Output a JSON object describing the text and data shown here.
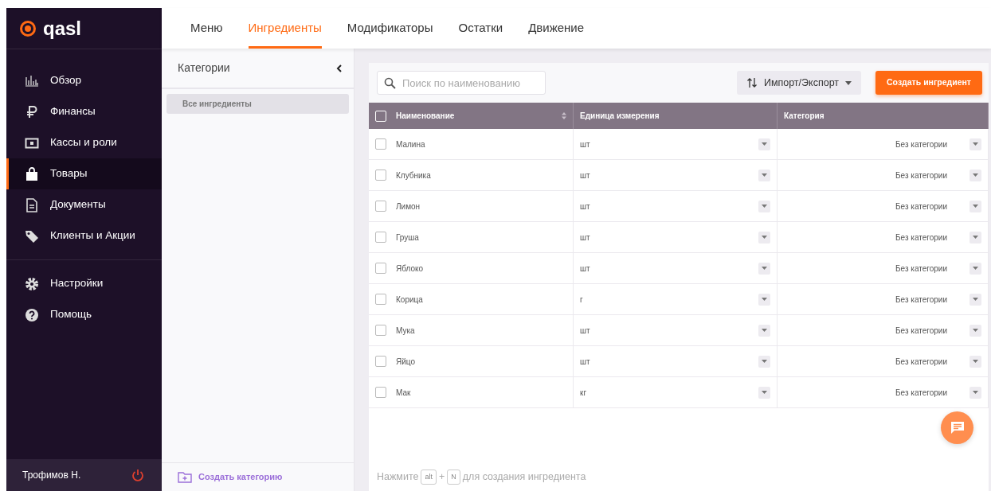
{
  "logo": {
    "text": "qasl"
  },
  "sidebar": {
    "items": [
      {
        "label": "Обзор",
        "selected": false
      },
      {
        "label": "Финансы",
        "selected": false
      },
      {
        "label": "Кассы и роли",
        "selected": false
      },
      {
        "label": "Товары",
        "selected": true
      },
      {
        "label": "Документы",
        "selected": false
      },
      {
        "label": "Клиенты и Акции",
        "selected": false
      },
      {
        "label": "Настройки",
        "selected": false
      },
      {
        "label": "Помощь",
        "selected": false
      }
    ],
    "user": "Трофимов Н."
  },
  "tabs": [
    {
      "label": "Меню",
      "selected": false
    },
    {
      "label": "Ингредиенты",
      "selected": true
    },
    {
      "label": "Модификаторы",
      "selected": false
    },
    {
      "label": "Остатки",
      "selected": false
    },
    {
      "label": "Движение",
      "selected": false
    }
  ],
  "categories": {
    "title": "Категории",
    "items": [
      {
        "label": "Все ингредиенты",
        "selected": true
      }
    ],
    "create": "Создать категорию"
  },
  "search": {
    "placeholder": "Поиск по наименованию"
  },
  "import_export": "Импорт/Экспорт",
  "create_button": "Создать ингредиент",
  "table": {
    "select_all_checked": false,
    "columns": [
      "Наименование",
      "Единица измерения",
      "Категория"
    ],
    "rows": [
      {
        "checked": false,
        "name": "Малина",
        "unit": "шт",
        "category": "Без категории"
      },
      {
        "checked": false,
        "name": "Клубника",
        "unit": "шт",
        "category": "Без категории"
      },
      {
        "checked": false,
        "name": "Лимон",
        "unit": "шт",
        "category": "Без категории"
      },
      {
        "checked": false,
        "name": "Груша",
        "unit": "шт",
        "category": "Без категории"
      },
      {
        "checked": false,
        "name": "Яблоко",
        "unit": "шт",
        "category": "Без категории"
      },
      {
        "checked": false,
        "name": "Корица",
        "unit": "г",
        "category": "Без категории"
      },
      {
        "checked": false,
        "name": "Мука",
        "unit": "шт",
        "category": "Без категории"
      },
      {
        "checked": false,
        "name": "Яйцо",
        "unit": "шт",
        "category": "Без категории"
      },
      {
        "checked": false,
        "name": "Мак",
        "unit": "кг",
        "category": "Без категории"
      }
    ]
  },
  "hint": {
    "before": "Нажмите",
    "key1": "alt",
    "plus": "+",
    "key2": "N",
    "after": "для создания ингредиента"
  }
}
